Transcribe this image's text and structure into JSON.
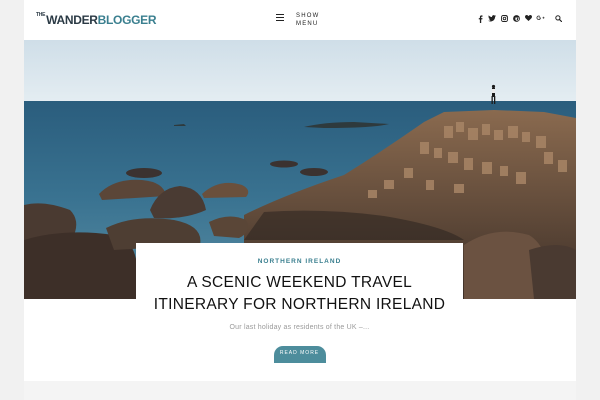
{
  "site": {
    "logo_small": "THE",
    "logo_main": "WANDER",
    "logo_accent": "BLOGGER"
  },
  "header": {
    "menu_label": "SHOW MENU",
    "social_icons": [
      "facebook-icon",
      "twitter-icon",
      "instagram-icon",
      "pinterest-icon",
      "heart-icon",
      "google-plus-icon"
    ]
  },
  "post": {
    "category": "NORTHERN IRELAND",
    "title": "A SCENIC WEEKEND TRAVEL ITINERARY FOR NORTHERN IRELAND",
    "excerpt": "Our last holiday as residents of the UK –...",
    "read_more": "READ MORE"
  },
  "colors": {
    "accent": "#3a7f8f",
    "button": "#4d8d9c",
    "sky": "#dce8ef",
    "sea": "#2c5f7c"
  }
}
